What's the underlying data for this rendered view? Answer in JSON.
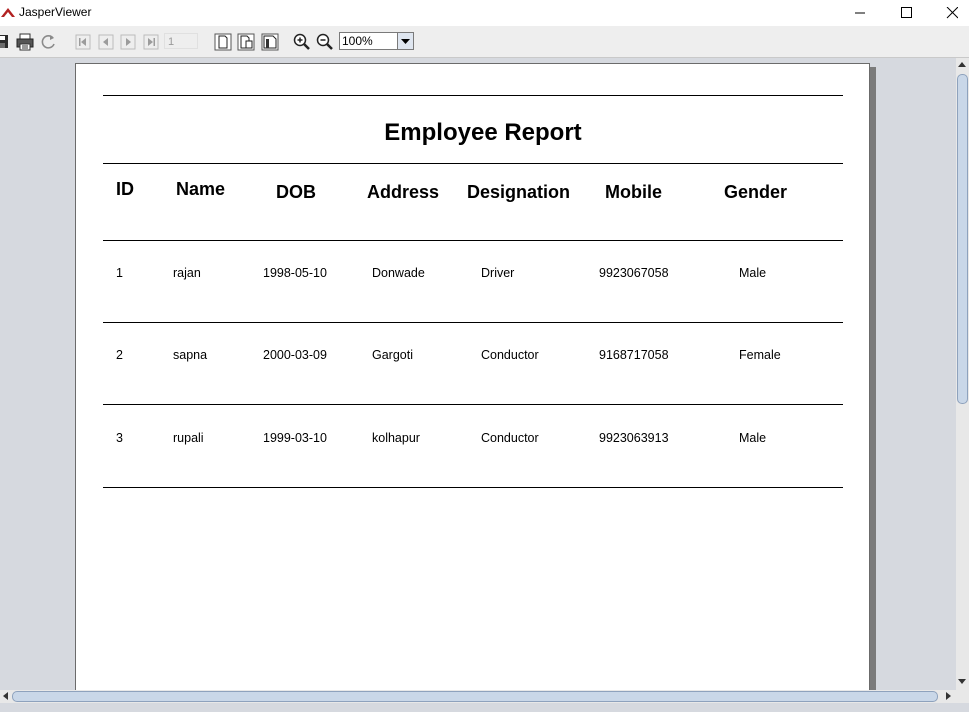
{
  "window": {
    "title": "JasperViewer"
  },
  "toolbar": {
    "page_number": "1",
    "zoom_value": "100%"
  },
  "report": {
    "title": "Employee Report",
    "columns": [
      "ID",
      "Name",
      "DOB",
      "Address",
      "Designation",
      "Mobile",
      "Gender"
    ],
    "rows": [
      [
        "1",
        "rajan",
        "1998-05-10",
        "Donwade",
        "Driver",
        "9923067058",
        "Male"
      ],
      [
        "2",
        "sapna",
        "2000-03-09",
        "Gargoti",
        "Conductor",
        "9168717058",
        "Female"
      ],
      [
        "3",
        "rupali",
        "1999-03-10",
        "kolhapur",
        "Conductor",
        "9923063913",
        "Male"
      ]
    ]
  },
  "colors": {
    "accent": "#c9d7e8",
    "app_icon": "#b22222"
  }
}
